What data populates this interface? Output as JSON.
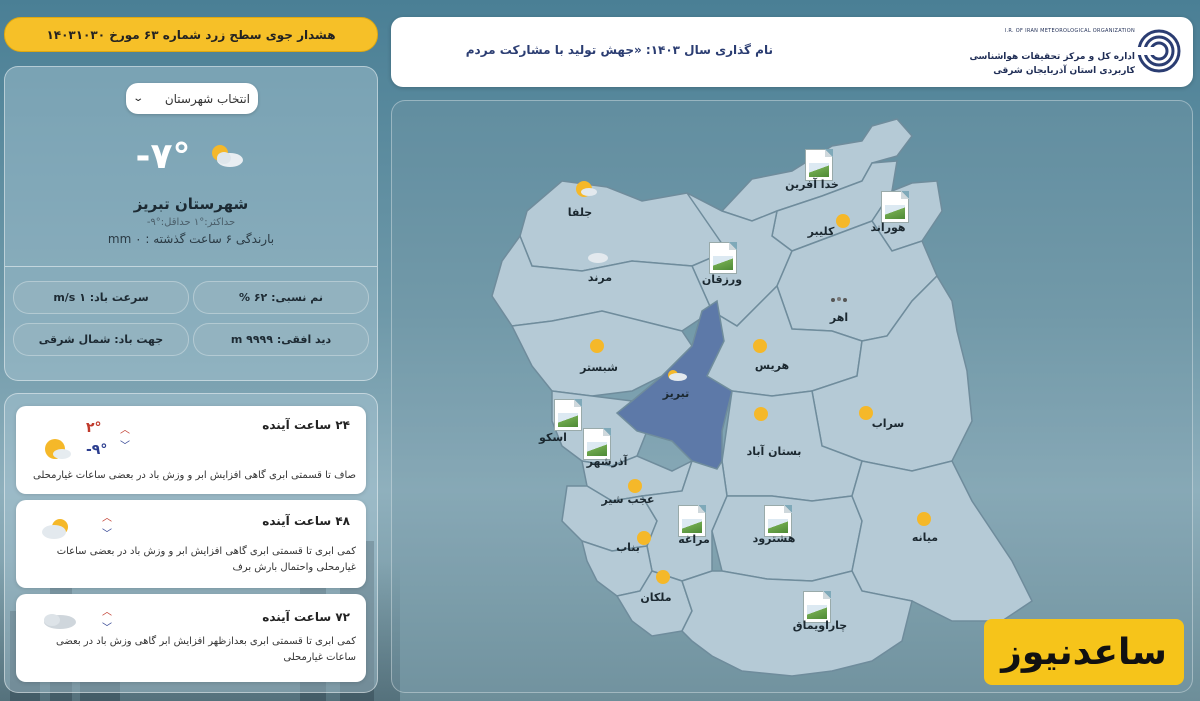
{
  "alert": {
    "text": "هشدار جوی سطح زرد شماره ۶۳ مورخ ۱۴۰۳۱۰۳۰"
  },
  "current": {
    "select_label": "انتخاب شهرستان",
    "temperature": "-۷°",
    "city_name": "شهرستان تبریز",
    "minmax": "حداکثر:°۱ حداقل:°۹-",
    "rain": "بارندگی ۶ ساعت گذشته : ۰ mm",
    "humidity": "نم نسبی: ۶۲ %",
    "wind_speed": "سرعت باد: ۱ m/s",
    "visibility": "دید افقی: ۹۹۹۹ m",
    "wind_dir": "جهت باد: شمال شرقی"
  },
  "forecast": [
    {
      "title": "۲۴ ساعت آینده",
      "max": "۲°",
      "min": "-۹°",
      "icon": "sun-cloud-icon",
      "desc": "صاف تا قسمتی ابری گاهی افزایش ابر و وزش باد در بعضی ساعات غیارمحلی"
    },
    {
      "title": "۴۸ ساعت آینده",
      "max": "",
      "min": "",
      "icon": "cloud-sun-icon",
      "desc": "کمی ابری تا قسمتی ابری گاهی افزایش ابر و وزش باد در بعضی ساعات غیارمحلی واحتمال بارش برف"
    },
    {
      "title": "۷۲ ساعت آینده",
      "max": "",
      "min": "",
      "icon": "cloud-icon",
      "desc": "کمی ابری تا قسمتی ابری بعدازظهر افزایش ابر گاهی وزش باد در بعضی ساعات غیارمحلی"
    }
  ],
  "header": {
    "slogan": "نام گذاری سال ۱۴۰۳: «جهش تولید با مشارکت مردم",
    "org_line1": "اداره کل و مرکز تحقیقات هواشناسی",
    "org_line2": "کاربردی استان آذربایجان شرقی",
    "org_en": "I.R. OF IRAN METEOROLOGICAL ORGANIZATION"
  },
  "map": {
    "cities": [
      {
        "name": "خدا آفرین",
        "icon": "broken-image"
      },
      {
        "name": "جلفا",
        "icon": "sun-cloud-icon"
      },
      {
        "name": "کلیبر",
        "icon": "sun-icon"
      },
      {
        "name": "هوراند",
        "icon": "broken-image"
      },
      {
        "name": "ورزقان",
        "icon": "broken-image"
      },
      {
        "name": "مرند",
        "icon": "cloud-icon"
      },
      {
        "name": "اهر",
        "icon": "cloud-icon"
      },
      {
        "name": "شبستر",
        "icon": "sun-icon"
      },
      {
        "name": "هریس",
        "icon": "sun-icon"
      },
      {
        "name": "تبریز",
        "icon": "cloud-icon"
      },
      {
        "name": "سراب",
        "icon": "sun-icon"
      },
      {
        "name": "اسکو",
        "icon": "broken-image"
      },
      {
        "name": "آذرشهر",
        "icon": "broken-image"
      },
      {
        "name": "بستان آباد",
        "icon": "sun-icon"
      },
      {
        "name": "عجب شیر",
        "icon": "sun-icon"
      },
      {
        "name": "مراغه",
        "icon": "broken-image"
      },
      {
        "name": "هشترود",
        "icon": "broken-image"
      },
      {
        "name": "میانه",
        "icon": "sun-icon"
      },
      {
        "name": "بناب",
        "icon": "sun-icon"
      },
      {
        "name": "ملکان",
        "icon": "sun-icon"
      },
      {
        "name": "چاراویماق",
        "icon": "broken-image"
      }
    ]
  },
  "brand": {
    "text": "ساعدنیوز"
  },
  "colors": {
    "accent": "#f6c028",
    "selected_region": "#5d79a8",
    "region": "#b5cad6"
  }
}
